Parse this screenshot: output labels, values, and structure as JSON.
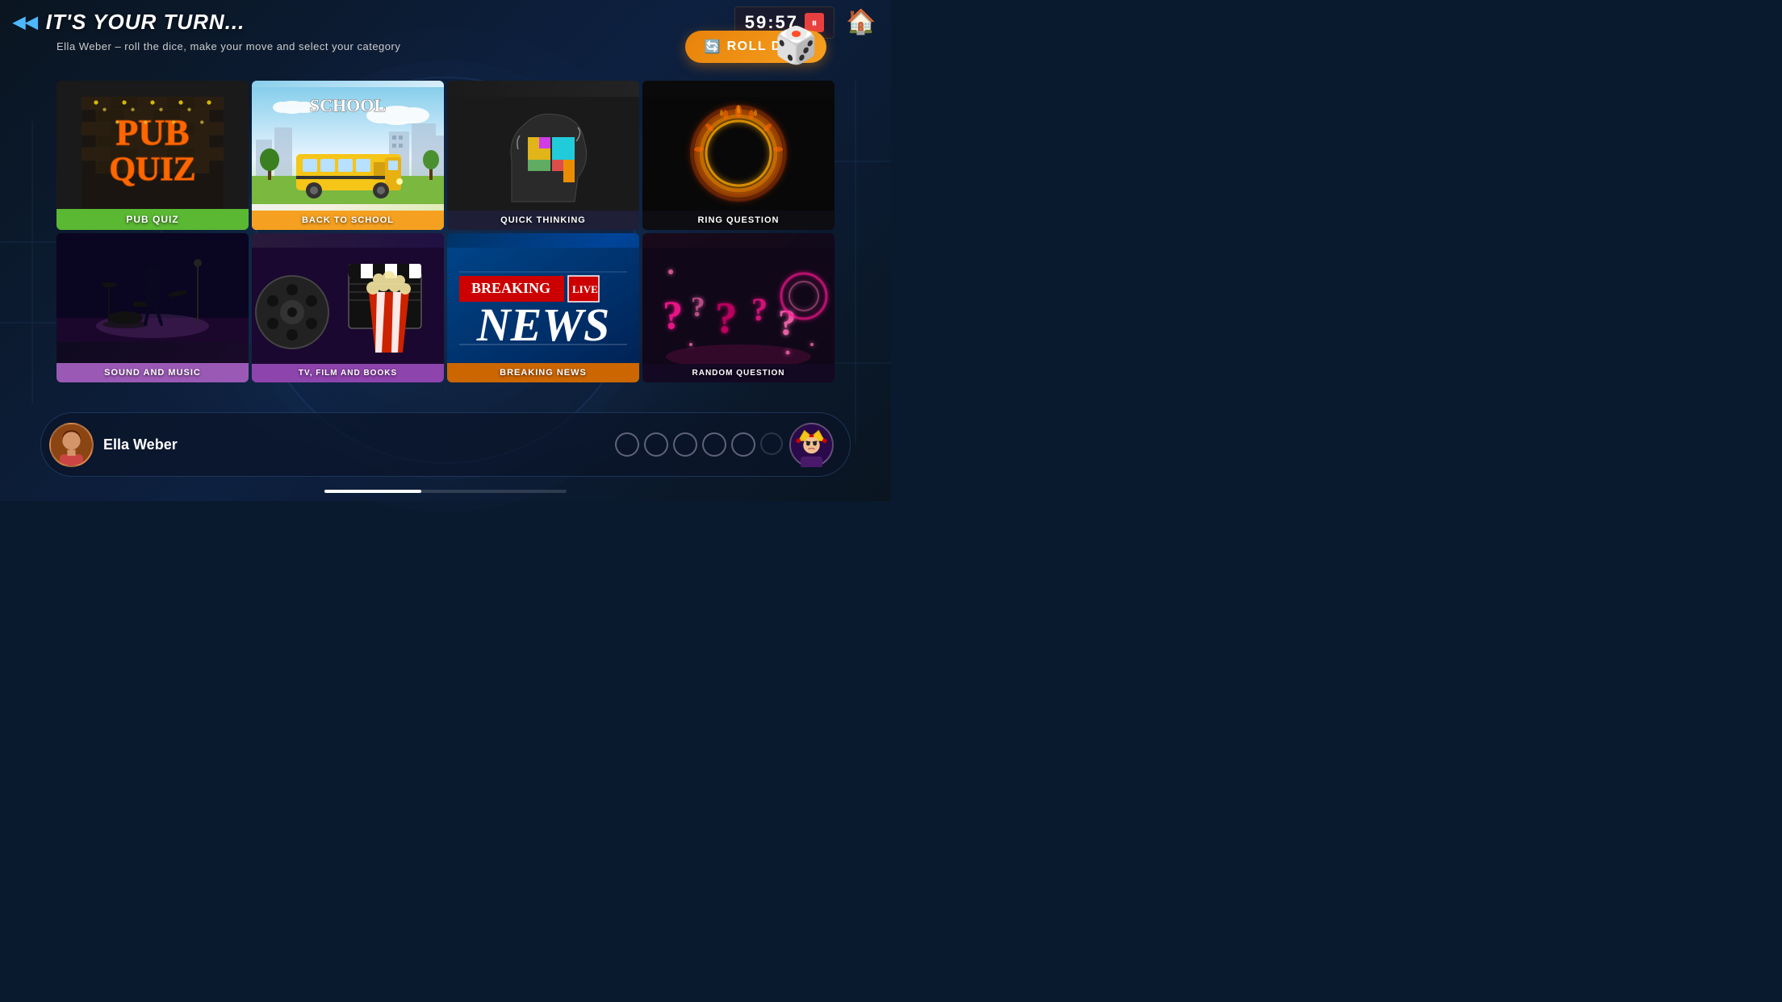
{
  "header": {
    "turn_title": "IT'S YOUR TURN...",
    "subtitle": "Ella Weber – roll the dice, make your move and select your category",
    "timer": "59:57",
    "roll_dice_label": "ROLL DICE",
    "home_label": "home"
  },
  "categories": [
    {
      "id": "pub-quiz",
      "label": "PUB QUIZ",
      "label_bg": "#5ab833",
      "row": 0,
      "col": 0
    },
    {
      "id": "back-to-school",
      "label": "BACK TO SCHOOL",
      "label_bg": "#f5a020",
      "row": 0,
      "col": 1
    },
    {
      "id": "quick-thinking",
      "label": "QUICK THINKING",
      "label_bg": "#1e1e3a",
      "row": 0,
      "col": 2
    },
    {
      "id": "ring-question",
      "label": "RING QUESTION",
      "label_bg": "#141420",
      "row": 0,
      "col": 3
    },
    {
      "id": "sound-and-music",
      "label": "SOUND AND MUSIC",
      "label_bg": "#9b59b6",
      "row": 1,
      "col": 0
    },
    {
      "id": "tv-film-books",
      "label": "TV, FILM AND BOOKS",
      "label_bg": "#8e44ad",
      "row": 1,
      "col": 1
    },
    {
      "id": "breaking-news",
      "label": "BREAKING NEWS",
      "label_bg": "#cc6600",
      "row": 1,
      "col": 2
    },
    {
      "id": "random-question",
      "label": "RANDOM QUESTION",
      "label_bg": "#1a0a2a",
      "row": 1,
      "col": 3
    }
  ],
  "player": {
    "name": "Ella Weber",
    "avatar_emoji": "👩"
  },
  "player2": {
    "avatar_emoji": "👸",
    "score_circles": 5,
    "filled_circles": 0
  },
  "progress": {
    "percent": 40
  },
  "breaking_news": {
    "breaking": "BREAKING",
    "live": "LIVE",
    "news": "NEWS"
  }
}
